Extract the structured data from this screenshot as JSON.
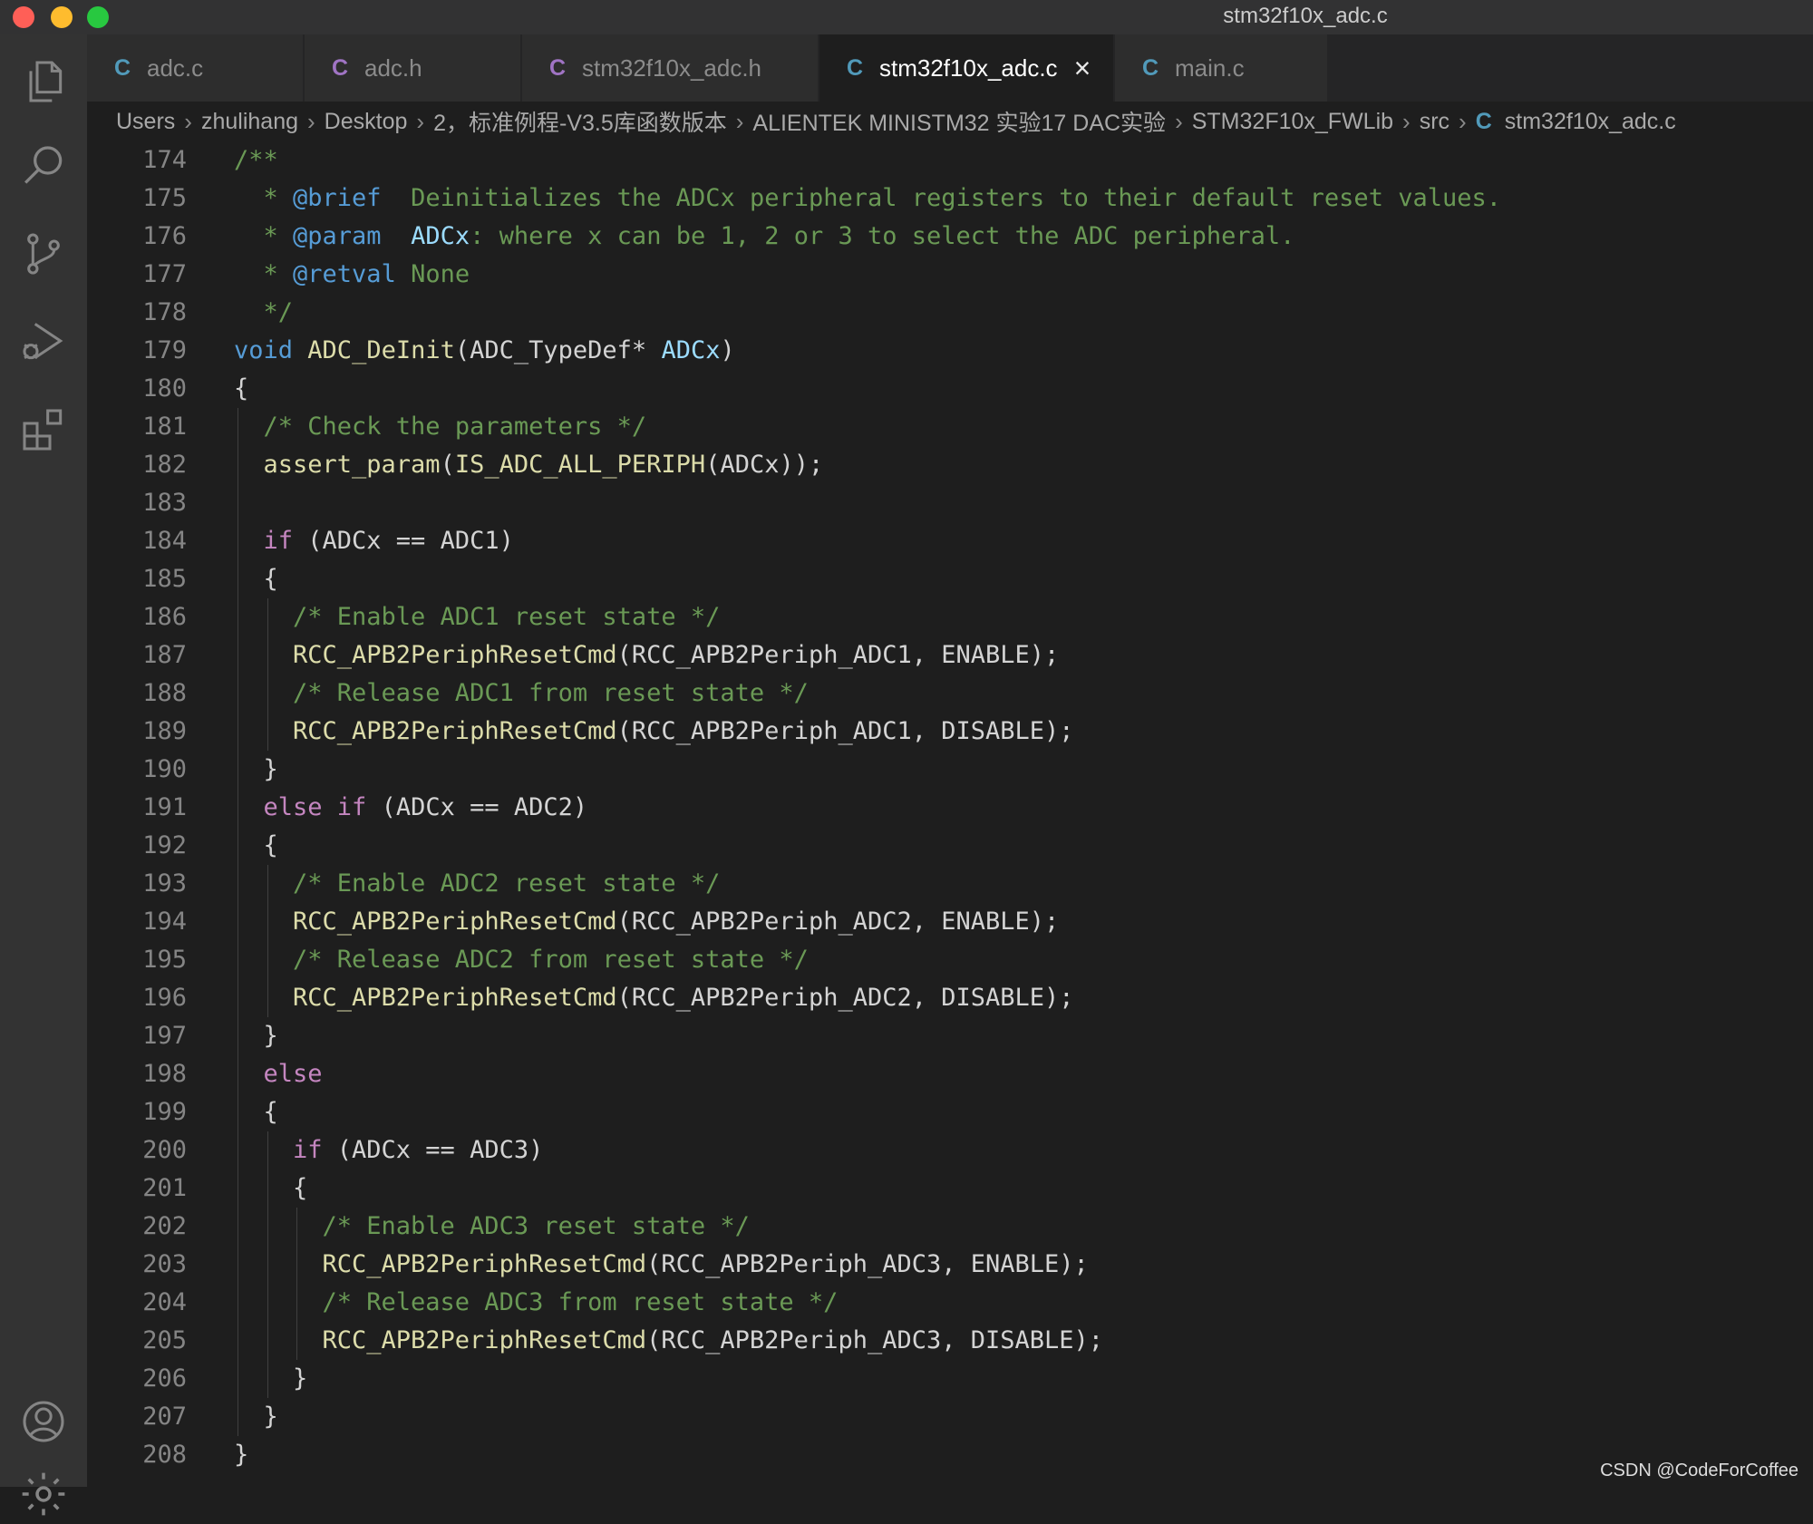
{
  "window": {
    "title": "stm32f10x_adc.c",
    "traffic_lights": [
      {
        "name": "close",
        "color": "#ff5f57"
      },
      {
        "name": "minimize",
        "color": "#febc2e"
      },
      {
        "name": "zoom",
        "color": "#28c840"
      }
    ]
  },
  "activity_bar": {
    "items": [
      {
        "icon": "files-icon",
        "label": "Explorer"
      },
      {
        "icon": "search-icon",
        "label": "Search"
      },
      {
        "icon": "source-control-icon",
        "label": "Source Control"
      },
      {
        "icon": "run-debug-icon",
        "label": "Run and Debug"
      },
      {
        "icon": "extensions-icon",
        "label": "Extensions"
      }
    ],
    "bottom": [
      {
        "icon": "account-icon",
        "label": "Accounts"
      },
      {
        "icon": "gear-icon",
        "label": "Manage"
      }
    ]
  },
  "tabs": [
    {
      "label": "adc.c",
      "icon_text": "C",
      "icon_color": "#519aba",
      "active": false
    },
    {
      "label": "adc.h",
      "icon_text": "C",
      "icon_color": "#a074c4",
      "active": false
    },
    {
      "label": "stm32f10x_adc.h",
      "icon_text": "C",
      "icon_color": "#a074c4",
      "active": false
    },
    {
      "label": "stm32f10x_adc.c",
      "icon_text": "C",
      "icon_color": "#519aba",
      "active": true,
      "close": "×"
    },
    {
      "label": "main.c",
      "icon_text": "C",
      "icon_color": "#519aba",
      "active": false
    }
  ],
  "breadcrumb": {
    "items": [
      "Users",
      "zhulihang",
      "Desktop",
      "2，标准例程-V3.5库函数版本",
      "ALIENTEK MINISTM32 实验17 DAC实验",
      "STM32F10x_FWLib",
      "src"
    ],
    "file_icon": "C",
    "file": "stm32f10x_adc.c",
    "separator": "›"
  },
  "editor": {
    "lines": [
      {
        "n": "174",
        "indent": 0,
        "tokens": [
          [
            "cm",
            "/**"
          ]
        ]
      },
      {
        "n": "175",
        "indent": 0,
        "tokens": [
          [
            "cm",
            "  * "
          ],
          [
            "tag",
            "@brief"
          ],
          [
            "cm",
            "  Deinitializes the ADCx peripheral registers to their default reset values."
          ]
        ]
      },
      {
        "n": "176",
        "indent": 0,
        "tokens": [
          [
            "cm",
            "  * "
          ],
          [
            "tag",
            "@param"
          ],
          [
            "cm",
            "  "
          ],
          [
            "par",
            "ADCx"
          ],
          [
            "cm",
            ": where x can be 1, 2 or 3 to select the ADC peripheral."
          ]
        ]
      },
      {
        "n": "177",
        "indent": 0,
        "tokens": [
          [
            "cm",
            "  * "
          ],
          [
            "tag",
            "@retval"
          ],
          [
            "cm",
            " None"
          ]
        ]
      },
      {
        "n": "178",
        "indent": 0,
        "tokens": [
          [
            "cm",
            "  */"
          ]
        ]
      },
      {
        "n": "179",
        "indent": 0,
        "tokens": [
          [
            "kw",
            "void"
          ],
          [
            "pl",
            " "
          ],
          [
            "fn",
            "ADC_DeInit"
          ],
          [
            "pl",
            "(ADC_TypeDef* "
          ],
          [
            "par",
            "ADCx"
          ],
          [
            "pl",
            ")"
          ]
        ]
      },
      {
        "n": "180",
        "indent": 0,
        "tokens": [
          [
            "pl",
            "{"
          ]
        ]
      },
      {
        "n": "181",
        "indent": 1,
        "tokens": [
          [
            "cm",
            "/* Check the parameters */"
          ]
        ]
      },
      {
        "n": "182",
        "indent": 1,
        "tokens": [
          [
            "fn",
            "assert_param"
          ],
          [
            "pl",
            "("
          ],
          [
            "fn",
            "IS_ADC_ALL_PERIPH"
          ],
          [
            "pl",
            "(ADCx));"
          ]
        ]
      },
      {
        "n": "183",
        "indent": 1,
        "tokens": []
      },
      {
        "n": "184",
        "indent": 1,
        "tokens": [
          [
            "ctrl",
            "if"
          ],
          [
            "pl",
            " (ADCx == ADC1)"
          ]
        ]
      },
      {
        "n": "185",
        "indent": 1,
        "tokens": [
          [
            "pl",
            "{"
          ]
        ]
      },
      {
        "n": "186",
        "indent": 2,
        "tokens": [
          [
            "cm",
            "/* Enable ADC1 reset state */"
          ]
        ]
      },
      {
        "n": "187",
        "indent": 2,
        "tokens": [
          [
            "fn",
            "RCC_APB2PeriphResetCmd"
          ],
          [
            "pl",
            "(RCC_APB2Periph_ADC1, ENABLE);"
          ]
        ]
      },
      {
        "n": "188",
        "indent": 2,
        "tokens": [
          [
            "cm",
            "/* Release ADC1 from reset state */"
          ]
        ]
      },
      {
        "n": "189",
        "indent": 2,
        "tokens": [
          [
            "fn",
            "RCC_APB2PeriphResetCmd"
          ],
          [
            "pl",
            "(RCC_APB2Periph_ADC1, DISABLE);"
          ]
        ]
      },
      {
        "n": "190",
        "indent": 1,
        "tokens": [
          [
            "pl",
            "}"
          ]
        ]
      },
      {
        "n": "191",
        "indent": 1,
        "tokens": [
          [
            "ctrl",
            "else"
          ],
          [
            "pl",
            " "
          ],
          [
            "ctrl",
            "if"
          ],
          [
            "pl",
            " (ADCx == ADC2)"
          ]
        ]
      },
      {
        "n": "192",
        "indent": 1,
        "tokens": [
          [
            "pl",
            "{"
          ]
        ]
      },
      {
        "n": "193",
        "indent": 2,
        "tokens": [
          [
            "cm",
            "/* Enable ADC2 reset state */"
          ]
        ]
      },
      {
        "n": "194",
        "indent": 2,
        "tokens": [
          [
            "fn",
            "RCC_APB2PeriphResetCmd"
          ],
          [
            "pl",
            "(RCC_APB2Periph_ADC2, ENABLE);"
          ]
        ]
      },
      {
        "n": "195",
        "indent": 2,
        "tokens": [
          [
            "cm",
            "/* Release ADC2 from reset state */"
          ]
        ]
      },
      {
        "n": "196",
        "indent": 2,
        "tokens": [
          [
            "fn",
            "RCC_APB2PeriphResetCmd"
          ],
          [
            "pl",
            "(RCC_APB2Periph_ADC2, DISABLE);"
          ]
        ]
      },
      {
        "n": "197",
        "indent": 1,
        "tokens": [
          [
            "pl",
            "}"
          ]
        ]
      },
      {
        "n": "198",
        "indent": 1,
        "tokens": [
          [
            "ctrl",
            "else"
          ]
        ]
      },
      {
        "n": "199",
        "indent": 1,
        "tokens": [
          [
            "pl",
            "{"
          ]
        ]
      },
      {
        "n": "200",
        "indent": 2,
        "tokens": [
          [
            "ctrl",
            "if"
          ],
          [
            "pl",
            " (ADCx == ADC3)"
          ]
        ]
      },
      {
        "n": "201",
        "indent": 2,
        "tokens": [
          [
            "pl",
            "{"
          ]
        ]
      },
      {
        "n": "202",
        "indent": 3,
        "tokens": [
          [
            "cm",
            "/* Enable ADC3 reset state */"
          ]
        ]
      },
      {
        "n": "203",
        "indent": 3,
        "tokens": [
          [
            "fn",
            "RCC_APB2PeriphResetCmd"
          ],
          [
            "pl",
            "(RCC_APB2Periph_ADC3, ENABLE);"
          ]
        ]
      },
      {
        "n": "204",
        "indent": 3,
        "tokens": [
          [
            "cm",
            "/* Release ADC3 from reset state */"
          ]
        ]
      },
      {
        "n": "205",
        "indent": 3,
        "tokens": [
          [
            "fn",
            "RCC_APB2PeriphResetCmd"
          ],
          [
            "pl",
            "(RCC_APB2Periph_ADC3, DISABLE);"
          ]
        ]
      },
      {
        "n": "206",
        "indent": 2,
        "tokens": [
          [
            "pl",
            "}"
          ]
        ]
      },
      {
        "n": "207",
        "indent": 1,
        "tokens": [
          [
            "pl",
            "}"
          ]
        ]
      },
      {
        "n": "208",
        "indent": 0,
        "tokens": [
          [
            "pl",
            "}"
          ]
        ]
      }
    ]
  },
  "watermark": "CSDN @CodeForCoffee"
}
